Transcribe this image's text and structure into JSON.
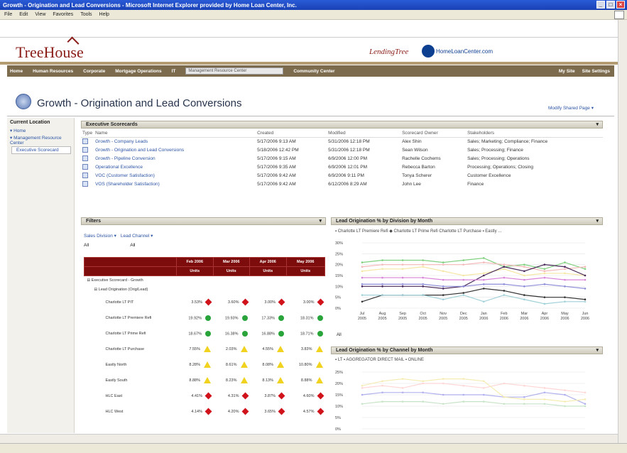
{
  "window": {
    "title": "Growth - Origination and Lead Conversions - Microsoft Internet Explorer provided by Home Loan Center, Inc.",
    "menus": [
      "File",
      "Edit",
      "View",
      "Favorites",
      "Tools",
      "Help"
    ]
  },
  "header": {
    "logo": "TreeHouse",
    "partner1": "LendingTree",
    "partner2": "HomeLoanCenter.com"
  },
  "nav": {
    "items": [
      "Home",
      "Human Resources",
      "Corporate",
      "Mortgage Operations",
      "IT"
    ],
    "search_placeholder": "Management Resource Center",
    "item_after_search": "Community Center",
    "right": [
      "My Site",
      "Site Settings"
    ]
  },
  "page": {
    "title": "Growth - Origination and Lead Conversions",
    "modify": "Modify Shared Page ▾"
  },
  "leftnav": {
    "heading": "Current Location",
    "items": [
      {
        "label": "▾ Home"
      },
      {
        "label": "▾ Management Resource Center"
      },
      {
        "label": "Executive Scorecard"
      }
    ]
  },
  "scorecards": {
    "header": "Executive Scorecards",
    "columns": [
      "Type",
      "Name",
      "Created",
      "Modified",
      "Scorecard Owner",
      "Stakeholders"
    ],
    "rows": [
      {
        "name": "Growth - Company Leads",
        "created": "5/17/2006 9:13 AM",
        "modified": "5/31/2006 12:18 PM",
        "owner": "Alex Shin",
        "stake": "Sales; Marketing; Compliance; Finance"
      },
      {
        "name": "Growth - Origination and Lead Conversions",
        "created": "5/18/2006 12:42 PM",
        "modified": "5/31/2006 12:18 PM",
        "owner": "Sean Wilson",
        "stake": "Sales; Processing; Finance"
      },
      {
        "name": "Growth - Pipeline Conversion",
        "created": "5/17/2006 9:15 AM",
        "modified": "6/9/2006 12:00 PM",
        "owner": "Rachelle Cochems",
        "stake": "Sales; Processing; Operations"
      },
      {
        "name": "Operational Excellence",
        "created": "5/17/2006 9:35 AM",
        "modified": "6/9/2006 12:01 PM",
        "owner": "Rebecca Barton",
        "stake": "Processing; Operations; Closing"
      },
      {
        "name": "VOC (Customer Satisfaction)",
        "created": "5/17/2006 9:42 AM",
        "modified": "6/9/2006 9:11 PM",
        "owner": "Tonya Scherer",
        "stake": "Customer Excellence"
      },
      {
        "name": "VOS (Shareholder Satisfaction)",
        "created": "5/17/2006 9:42 AM",
        "modified": "6/12/2006 8:29 AM",
        "owner": "John Lee",
        "stake": "Finance"
      }
    ]
  },
  "filters": {
    "header": "Filters",
    "filter1": "Sales Division ▾",
    "filter2": "Lead Channel ▾",
    "val1": "All",
    "val2": "All"
  },
  "grid": {
    "months": [
      "Feb 2006",
      "Mar 2006",
      "Apr 2006",
      "May 2006"
    ],
    "unit": "Units",
    "group1": "⊟ Executive Scorecard - Growth",
    "group2": "⊟ Lead Origination (Orig/Lead)",
    "rows": [
      {
        "label": "Charlotte LT PIT",
        "vals": [
          "3.53%",
          "3.60%",
          "3.00%",
          "3.00%"
        ],
        "ind": [
          "red",
          "red",
          "red",
          "red"
        ]
      },
      {
        "label": "Charlotte LT Premiere Refi",
        "vals": [
          "19.92%",
          "19.93%",
          "17.33%",
          "18.31%"
        ],
        "ind": [
          "green",
          "green",
          "green",
          "green"
        ]
      },
      {
        "label": "Charlotte LT Prime Refi",
        "vals": [
          "18.67%",
          "16.38%",
          "16.88%",
          "18.71%"
        ],
        "ind": [
          "green",
          "green",
          "green",
          "green"
        ]
      },
      {
        "label": "Charlotte LT Purchase",
        "vals": [
          "7.55%",
          "2.03%",
          "4.55%",
          "3.83%"
        ],
        "ind": [
          "yellow",
          "yellow",
          "yellow",
          "yellow"
        ]
      },
      {
        "label": "Eastly North",
        "vals": [
          "8.28%",
          "8.61%",
          "8.08%",
          "10.80%"
        ],
        "ind": [
          "yellow",
          "yellow",
          "yellow",
          "yellow"
        ]
      },
      {
        "label": "Eastly South",
        "vals": [
          "8.88%",
          "8.23%",
          "8.13%",
          "8.88%"
        ],
        "ind": [
          "yellow",
          "yellow",
          "yellow",
          "yellow"
        ]
      },
      {
        "label": "HLC East",
        "vals": [
          "4.41%",
          "4.31%",
          "3.87%",
          "4.60%"
        ],
        "ind": [
          "red",
          "red",
          "red",
          "red"
        ]
      },
      {
        "label": "HLC West",
        "vals": [
          "4.14%",
          "4.20%",
          "3.65%",
          "4.57%"
        ],
        "ind": [
          "red",
          "red",
          "red",
          "red"
        ]
      }
    ]
  },
  "chart1": {
    "header": "Lead Origination % by Division by Month",
    "legend": "▪ Charlotte LT Premiere Refi ◆ Charlotte LT Prime Refi   Charlotte LT Purchase ▪ Eastly ...",
    "footer": "All"
  },
  "chart2": {
    "header": "Lead Origination % by Channel by Month",
    "legend": "▪ LT ▪ AGGREGATOR   DIRECT MAIL ▪ ONLINE"
  },
  "chart_data": [
    {
      "type": "line",
      "title": "Lead Origination % by Division by Month",
      "categories": [
        "Jul 2005",
        "Aug 2005",
        "Sep 2005",
        "Oct 2005",
        "Nov 2005",
        "Dec 2005",
        "Jan 2006",
        "Feb 2006",
        "Mar 2006",
        "Apr 2006",
        "May 2006",
        "Jun 2006"
      ],
      "ylim": [
        0,
        30
      ],
      "yticks": [
        "30%",
        "25%",
        "20%",
        "15%",
        "10%",
        "5%",
        "0%"
      ],
      "series": [
        {
          "name": "Charlotte LT Premiere Refi",
          "color": "#7fd07f",
          "values": [
            21,
            22,
            22,
            22,
            21,
            22,
            23,
            19,
            20,
            18,
            21,
            18
          ]
        },
        {
          "name": "Charlotte LT Prime Refi",
          "color": "#f4b8b8",
          "values": [
            19,
            20,
            20,
            20,
            20,
            20,
            21,
            20,
            19,
            17,
            18,
            19
          ]
        },
        {
          "name": "Charlotte LT Purchase",
          "color": "#f5e6a3",
          "values": [
            17,
            18,
            18,
            19,
            17,
            15,
            16,
            18,
            15,
            16,
            16,
            15
          ]
        },
        {
          "name": "",
          "color": "#4a2a5a",
          "values": [
            10,
            10,
            10,
            10,
            9,
            10,
            15,
            19,
            17,
            20,
            19,
            15
          ]
        },
        {
          "name": "",
          "color": "#d983d9",
          "values": [
            14,
            14,
            14,
            14,
            13,
            13,
            13,
            14,
            13,
            14,
            13,
            13
          ]
        },
        {
          "name": "",
          "color": "#8d8dd9",
          "values": [
            11,
            11,
            11,
            11,
            10,
            10,
            11,
            11,
            10,
            11,
            10,
            9
          ]
        },
        {
          "name": "",
          "color": "#333333",
          "values": [
            3,
            6,
            6,
            6,
            6,
            7,
            9,
            8,
            6,
            5,
            5,
            4
          ]
        },
        {
          "name": "",
          "color": "#a0d0d8",
          "values": [
            6,
            6,
            6,
            6,
            4,
            6,
            3,
            6,
            4,
            2,
            3,
            3
          ]
        }
      ]
    },
    {
      "type": "line",
      "title": "Lead Origination % by Channel by Month",
      "ylim": [
        0,
        25
      ],
      "yticks": [
        "25%",
        "20%",
        "15%",
        "10%",
        "5%",
        "0%"
      ],
      "series": [
        {
          "name": "LT",
          "color": "#ffd6d6",
          "values": [
            18,
            19,
            18,
            20,
            20,
            19,
            18,
            20,
            19,
            18,
            17,
            16
          ]
        },
        {
          "name": "AGGREGATOR",
          "color": "#b0b0ee",
          "values": [
            15,
            16,
            16,
            16,
            15,
            15,
            15,
            14,
            14,
            16,
            15,
            11
          ]
        },
        {
          "name": "DIRECT MAIL",
          "color": "#f5ecb3",
          "values": [
            19,
            21,
            22,
            21,
            22,
            22,
            21,
            14,
            13,
            13,
            12,
            13
          ]
        },
        {
          "name": "ONLINE",
          "color": "#c8e4c8",
          "values": [
            11,
            12,
            12,
            12,
            11,
            12,
            12,
            11,
            11,
            11,
            10,
            10
          ]
        }
      ]
    }
  ]
}
